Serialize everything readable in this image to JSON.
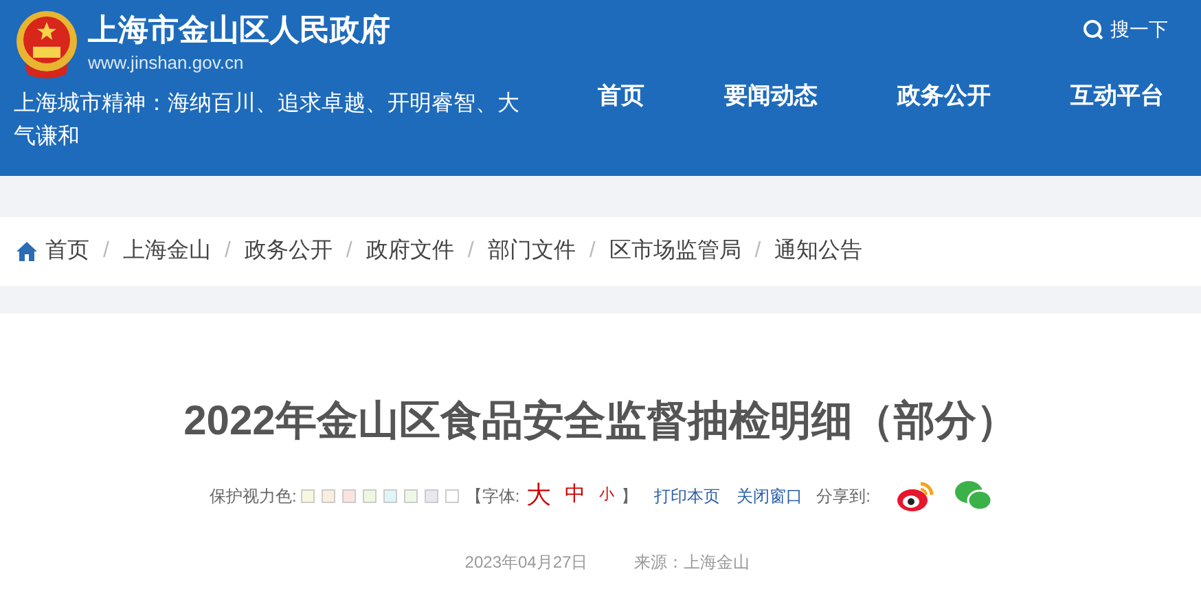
{
  "header": {
    "site_title": "上海市金山区人民政府",
    "site_url": "www.jinshan.gov.cn",
    "motto": "上海城市精神：海纳百川、追求卓越、开明睿智、大气谦和",
    "search_label": "搜一下",
    "nav": [
      {
        "label": "首页"
      },
      {
        "label": "要闻动态"
      },
      {
        "label": "政务公开"
      },
      {
        "label": "互动平台"
      }
    ]
  },
  "breadcrumb_separator": "/",
  "breadcrumb": [
    "首页",
    "上海金山",
    "政务公开",
    "政府文件",
    "部门文件",
    "区市场监管局",
    "通知公告"
  ],
  "article": {
    "title": "2022年金山区食品安全监督抽检明细（部分）",
    "eye_care_label": "保护视力色:",
    "swatches": [
      {
        "color": "#f7f7e0"
      },
      {
        "color": "#fbeedf"
      },
      {
        "color": "#fbe3e0"
      },
      {
        "color": "#eef8e0"
      },
      {
        "color": "#def6f8"
      },
      {
        "color": "#eef8e6"
      },
      {
        "color": "#e8e8ee"
      },
      {
        "color": "#ffffff"
      }
    ],
    "font_label": "【字体:",
    "font_sizes": [
      {
        "label": "大",
        "kind": "large"
      },
      {
        "label": "中",
        "kind": "medium"
      },
      {
        "label": "小",
        "kind": "small"
      }
    ],
    "font_close": "】",
    "print": "打印本页",
    "close_window": "关闭窗口",
    "share_label": "分享到:",
    "date": "2023年04月27日",
    "source": "来源：上海金山"
  }
}
